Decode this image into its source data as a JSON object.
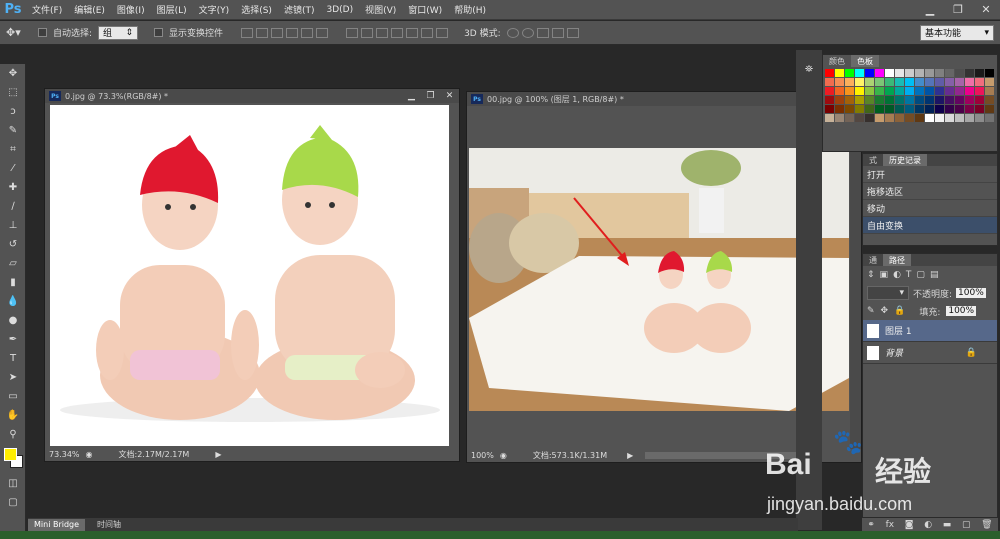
{
  "app": {
    "logo": "Ps"
  },
  "menu": [
    "文件(F)",
    "编辑(E)",
    "图像(I)",
    "图层(L)",
    "文字(Y)",
    "选择(S)",
    "滤镜(T)",
    "3D(D)",
    "视图(V)",
    "窗口(W)",
    "帮助(H)"
  ],
  "options": {
    "auto_select": "自动选择:",
    "group": "组",
    "show_transform": "显示变换控件",
    "mode3d": "3D 模式:",
    "workspace": "基本功能"
  },
  "doc1": {
    "title": "0.jpg @ 73.3%(RGB/8#) *",
    "zoom": "73.34%",
    "doc_size": "文档:2.17M/2.17M"
  },
  "doc2": {
    "title": "00.jpg @ 100% (图层 1, RGB/8#) *",
    "zoom": "100%",
    "doc_size": "文档:573.1K/1.31M"
  },
  "colors_panel": {
    "tabs": [
      "颜色",
      "色板"
    ]
  },
  "history": {
    "tabs": [
      "式",
      "历史记录"
    ],
    "items": [
      "打开",
      "拖移选区",
      "移动",
      "自由变换"
    ]
  },
  "layers": {
    "tabs": [
      "通",
      "路径"
    ],
    "opacity_label": "不透明度:",
    "opacity": "100%",
    "fill_label": "填充:",
    "fill": "100%",
    "items": [
      "图层 1",
      "背景"
    ]
  },
  "bottom_tabs": [
    "Mini Bridge",
    "时间轴"
  ],
  "watermark": {
    "brand": "Bai",
    "brand2": "经验",
    "url": "jingyan.baidu.com"
  },
  "accent": "#4fb1f5"
}
